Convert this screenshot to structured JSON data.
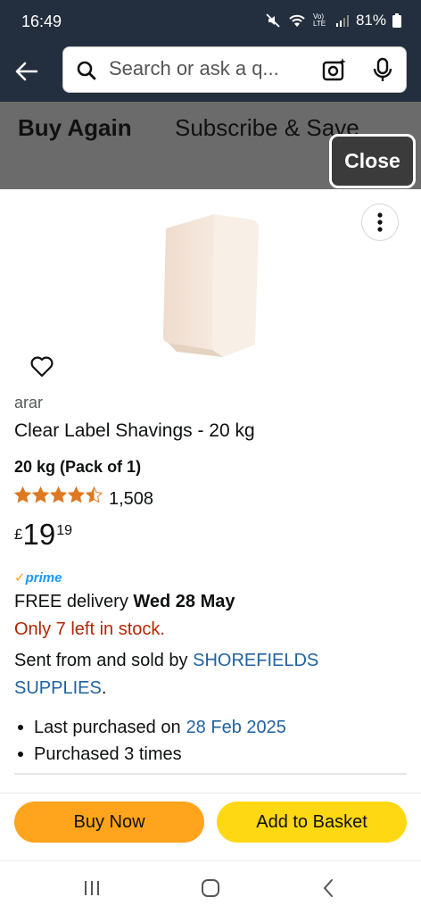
{
  "status_bar": {
    "time": "16:49",
    "battery": "81%",
    "volte": "Vo) LTE"
  },
  "search": {
    "placeholder": "Search or ask a q..."
  },
  "background_tabs": {
    "active": "Buy Again",
    "other": "Subscribe & Save"
  },
  "close_label": "Close",
  "product": {
    "brand": "arar",
    "title": "Clear Label Shavings - 20 kg",
    "variant": "20 kg (Pack of 1)",
    "rating": 4.5,
    "rating_max": 5,
    "rating_count": "1,508",
    "price": {
      "currency": "£",
      "whole": "19",
      "fraction": "19"
    },
    "prime_label": "prime",
    "delivery_prefix": "FREE delivery",
    "delivery_date": "Wed 28 May",
    "stock_text": "Only 7 left in stock.",
    "seller_prefix": "Sent from and sold by",
    "seller_name": "SHOREFIELDS SUPPLIES",
    "seller_suffix": "."
  },
  "purchase_history": {
    "last_purchased_prefix": "Last purchased on",
    "last_purchased_date": "28 Feb 2025",
    "purchased_times": "Purchased 3 times"
  },
  "actions": {
    "buy_now": "Buy Now",
    "add_to_basket": "Add to Basket"
  },
  "colors": {
    "header": "#232f3e",
    "buy_now": "#ffa41c",
    "add_to_basket": "#ffd814",
    "stock": "#b12704",
    "link": "#2162a1",
    "star": "#de7921"
  }
}
